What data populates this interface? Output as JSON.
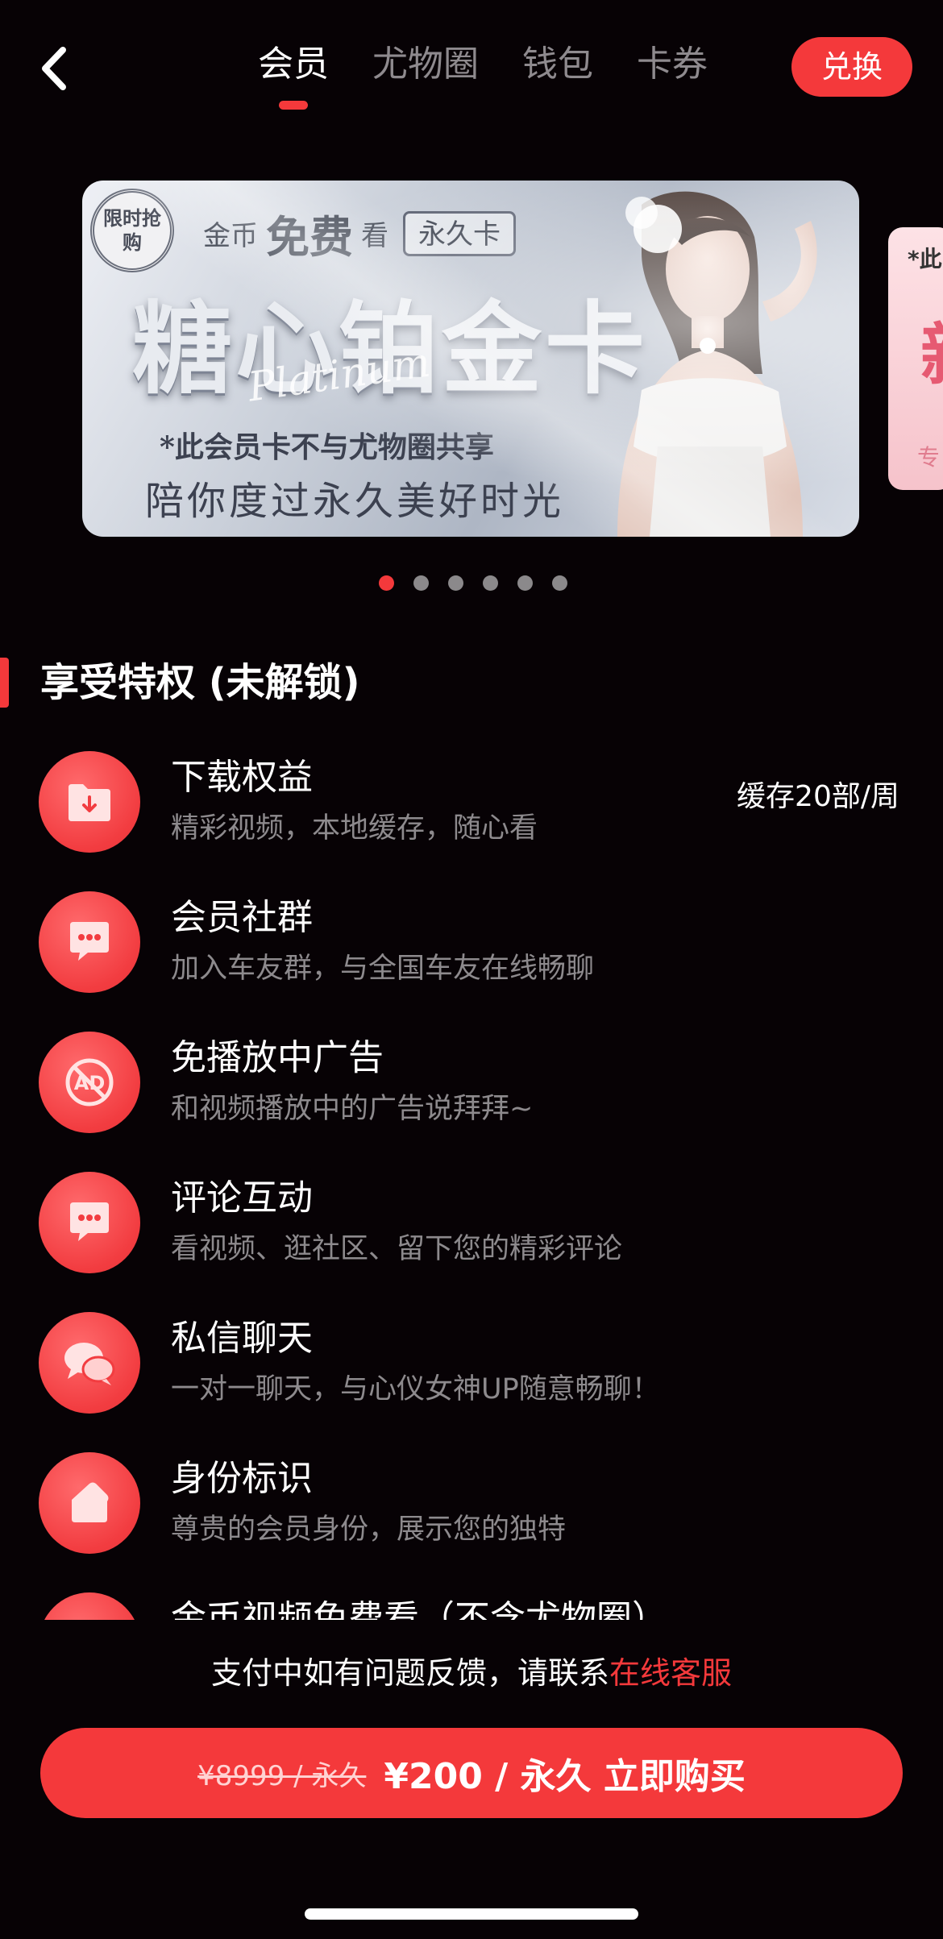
{
  "header": {
    "tabs": [
      {
        "label": "会员",
        "active": true
      },
      {
        "label": "尤物圈",
        "active": false
      },
      {
        "label": "钱包",
        "active": false
      },
      {
        "label": "卡券",
        "active": false
      }
    ],
    "redeem_label": "兑换"
  },
  "banner": {
    "badge": "限时抢购",
    "top_small_1": "金币",
    "top_big": "免费",
    "top_small_2": "看",
    "top_box": "永久卡",
    "title": "糖心铂金卡",
    "script": "Platinum",
    "note": "*此会员卡不与尤物圈共享",
    "slogan": "陪你度过永久美好时光",
    "dot_count": 6,
    "active_dot": 0
  },
  "next_banner": {
    "t1": "*此",
    "t2": "新",
    "t3": "专"
  },
  "section": {
    "title": "享受特权 (未解锁)"
  },
  "privileges": [
    {
      "icon": "download-folder-icon",
      "name": "下载权益",
      "desc": "精彩视频，本地缓存，随心看",
      "right": "缓存20部/周"
    },
    {
      "icon": "chat-bubble-icon",
      "name": "会员社群",
      "desc": "加入车友群，与全国车友在线畅聊",
      "right": ""
    },
    {
      "icon": "no-ads-icon",
      "name": "免播放中广告",
      "desc": "和视频播放中的广告说拜拜~",
      "right": ""
    },
    {
      "icon": "comment-bubble-icon",
      "name": "评论互动",
      "desc": "看视频、逛社区、留下您的精彩评论",
      "right": ""
    },
    {
      "icon": "private-chat-icon",
      "name": "私信聊天",
      "desc": "一对一聊天，与心仪女神UP随意畅聊！",
      "right": ""
    },
    {
      "icon": "identity-tag-icon",
      "name": "身份标识",
      "desc": "尊贵的会员身份，展示您的独特",
      "right": ""
    },
    {
      "icon": "coin-video-icon",
      "name": "金币视频免费看（不含尤物圈）",
      "desc": "",
      "right": ""
    }
  ],
  "support": {
    "text": "支付中如有问题反馈，请联系",
    "link": "在线客服"
  },
  "buy": {
    "old_price": "¥8999 / 永久",
    "label": "¥200 / 永久 立即购买"
  },
  "colors": {
    "accent": "#f4393b",
    "background": "#070205",
    "muted_text": "#8d8a8d"
  }
}
